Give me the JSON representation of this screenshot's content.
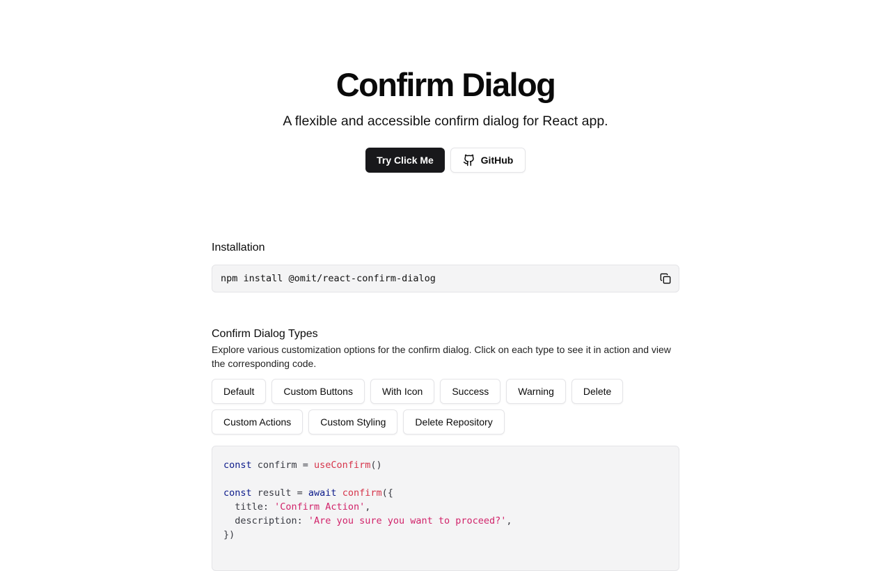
{
  "hero": {
    "title": "Confirm Dialog",
    "subtitle": "A flexible and accessible confirm dialog for React app.",
    "primary_button": "Try Click Me",
    "github_button": "GitHub",
    "github_icon": "github-icon"
  },
  "installation": {
    "heading": "Installation",
    "command": "npm install @omit/react-confirm-dialog",
    "copy_icon": "copy-icon"
  },
  "types": {
    "heading": "Confirm Dialog Types",
    "description": "Explore various customization options for the confirm dialog. Click on each type to see it in action and view the corresponding code.",
    "row1": [
      "Default",
      "Custom Buttons",
      "With Icon",
      "Success",
      "Warning",
      "Delete"
    ],
    "row2": [
      "Custom Actions",
      "Custom Styling",
      "Delete Repository"
    ]
  },
  "code": {
    "line1": {
      "kw": "const",
      "var": " confirm = ",
      "fn": "useConfirm",
      "rest": "()"
    },
    "line3": {
      "kw": "const",
      "var": " result = ",
      "kw2": "await",
      "sp": " ",
      "fn": "confirm",
      "rest": "({"
    },
    "line4": {
      "key": "  title: ",
      "str": "'Confirm Action'",
      "rest": ","
    },
    "line5": {
      "key": "  description: ",
      "str": "'Are you sure you want to proceed?'",
      "rest": ","
    },
    "line6": "})"
  },
  "colors": {
    "primary_button_bg": "#18181b",
    "code_keyword": "#0b1a8a",
    "code_function": "#d6344a",
    "code_string": "#d1236a"
  }
}
